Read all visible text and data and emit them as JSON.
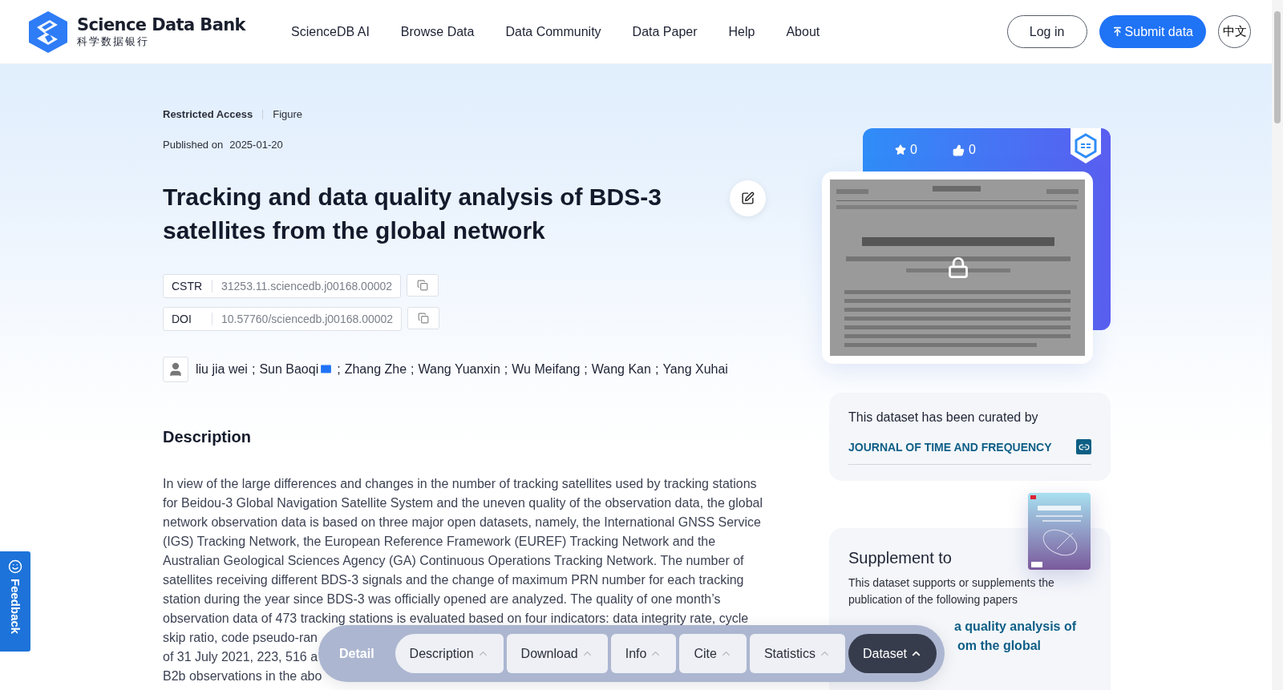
{
  "header": {
    "logo_title": "Science Data Bank",
    "logo_subtitle": "科学数据银行",
    "nav": [
      "ScienceDB AI",
      "Browse Data",
      "Data Community",
      "Data Paper",
      "Help",
      "About"
    ],
    "login": "Log in",
    "submit": "Submit data",
    "language": "中文"
  },
  "meta": {
    "access": "Restricted Access",
    "type": "Figure",
    "published_label": "Published on",
    "published_date": "2025-01-20"
  },
  "title": "Tracking and data quality analysis of BDS-3 satellites from the global network",
  "identifiers": [
    {
      "label": "CSTR",
      "value": "31253.11.sciencedb.j00168.00002"
    },
    {
      "label": "DOI",
      "value": "10.57760/sciencedb.j00168.00002"
    }
  ],
  "author_separator": ";",
  "authors": [
    {
      "name": "liu jia wei",
      "email": false
    },
    {
      "name": "Sun Baoqi",
      "email": true
    },
    {
      "name": "Zhang Zhe",
      "email": false
    },
    {
      "name": "Wang Yuanxin",
      "email": false
    },
    {
      "name": "Wu Meifang",
      "email": false
    },
    {
      "name": "Wang Kan",
      "email": false
    },
    {
      "name": "Yang Xuhai",
      "email": false
    }
  ],
  "description": {
    "heading": "Description",
    "lines": [
      " In view of the large differences and changes in the number of tracking satellites used by tracking stations",
      "for Beidou-3 Global Navigation Satellite System and the uneven quality of the observation data, the global",
      "network observation data is based on three major open datasets, namely, the International GNSS Service",
      "(IGS) Tracking Network, the European Reference Framework (EUREF) Tracking Network and the",
      "Australian Geological Sciences Agency (GA) Continuous Operations Tracking Network. The number of",
      "satellites receiving different BDS-3 signals and the change of maximum PRN number for each tracking",
      "station during the year since BDS-3 was officially opened are analyzed. The quality of one month’s",
      "observation data of 473 tracking stations is evaluated based on four indicators: data integrity rate, cycle",
      "skip ratio, code pseudo-ran",
      "of 31 July 2021, 223, 516 a",
      "B2b observations in the abo"
    ]
  },
  "stats": {
    "favorites": "0",
    "likes": "0"
  },
  "preview": {
    "kind": "picture",
    "locked": true
  },
  "curation": {
    "text": "This dataset has been curated by",
    "journal": "JOURNAL OF TIME AND FREQUENCY"
  },
  "supplement": {
    "heading": "Supplement to",
    "text": "This dataset supports or supplements the publication of the following papers",
    "paper_title_lines": [
      "a quality analysis of",
      "om the global"
    ]
  },
  "feedback": "Feedback",
  "detail_bar": {
    "label": "Detail",
    "tabs": [
      {
        "label": "Description",
        "selected": false
      },
      {
        "label": "Download",
        "selected": false
      },
      {
        "label": "Info",
        "selected": false
      },
      {
        "label": "Cite",
        "selected": false
      },
      {
        "label": "Statistics",
        "selected": false
      },
      {
        "label": "Dataset",
        "selected": true
      }
    ]
  }
}
